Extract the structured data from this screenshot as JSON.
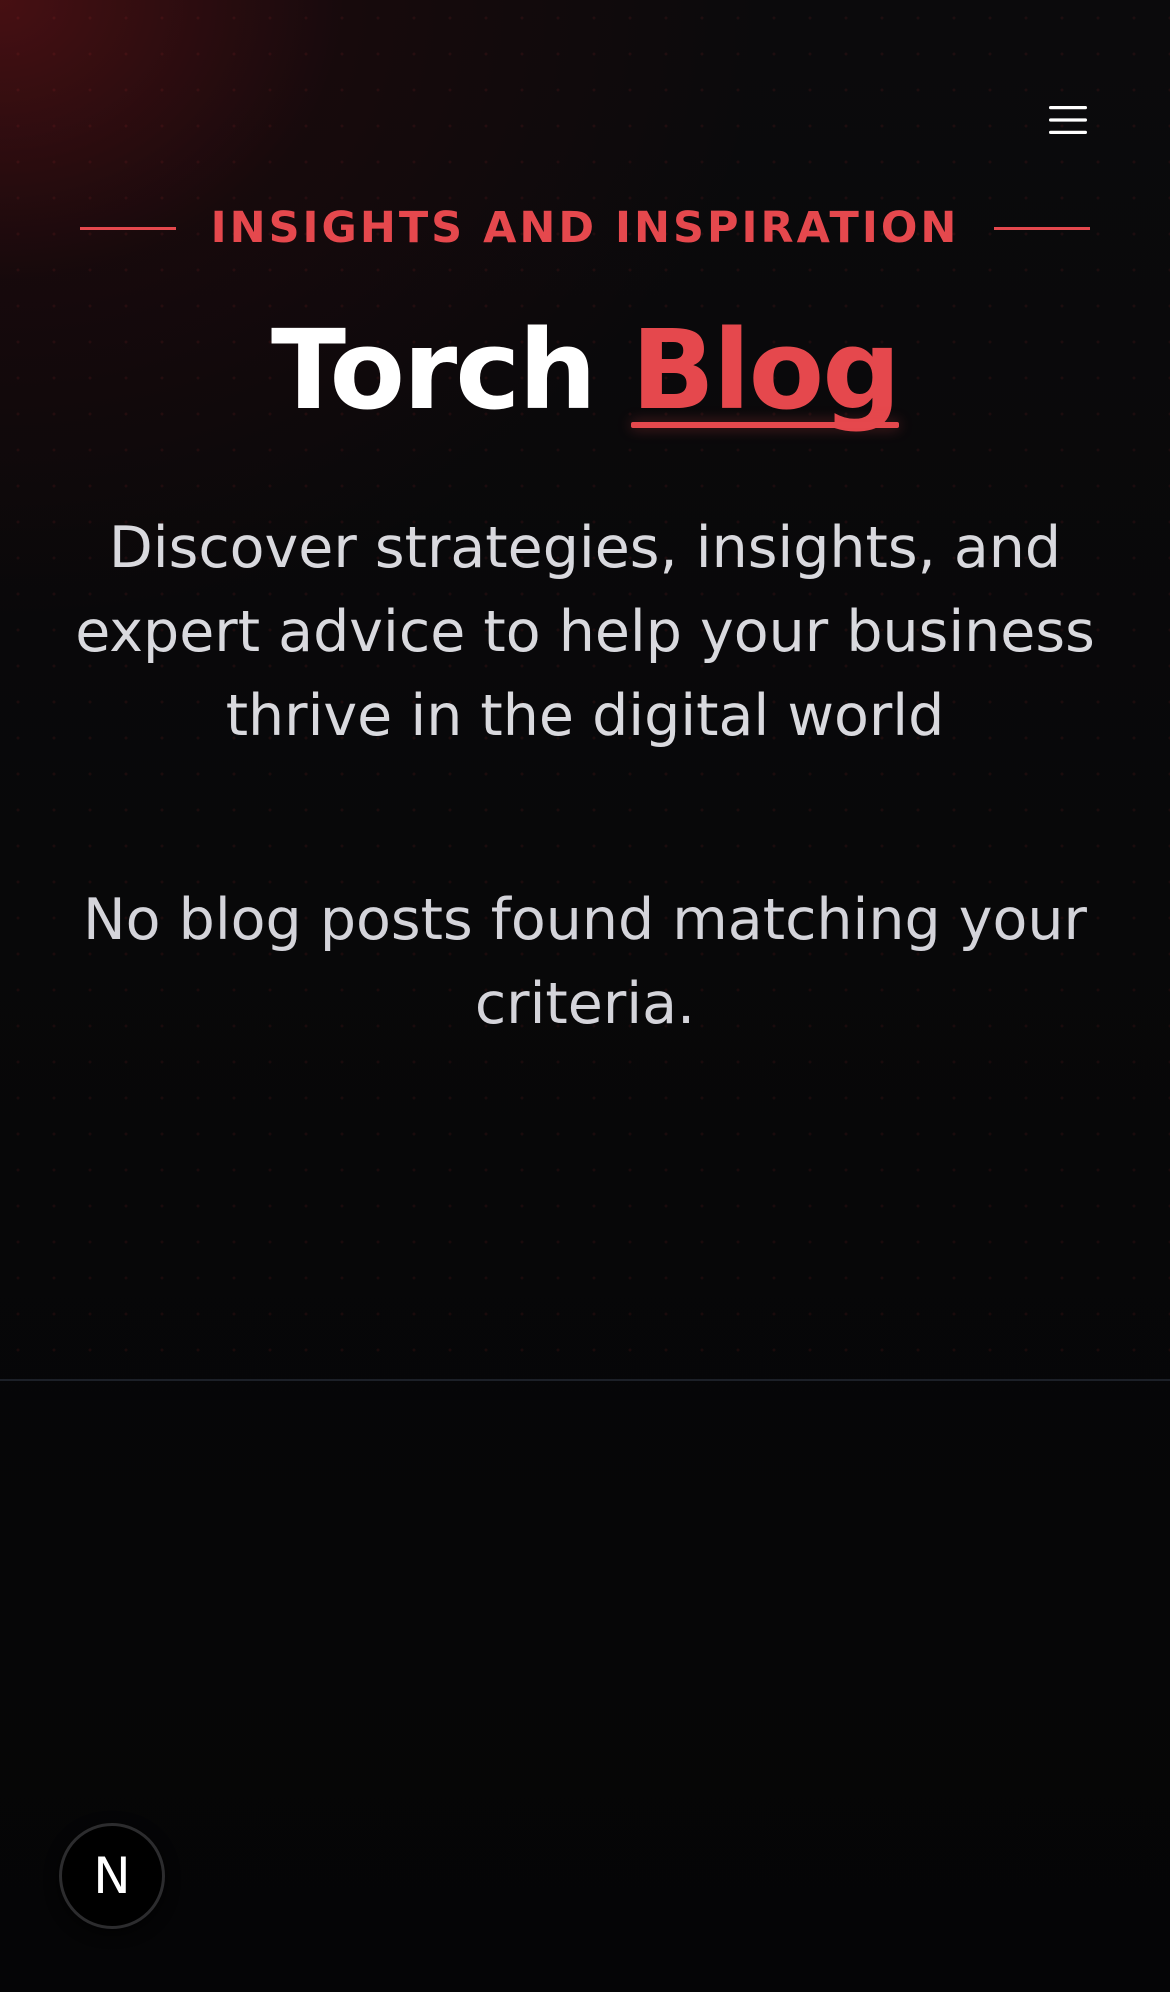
{
  "header": {
    "menu_icon": "hamburger-menu-icon"
  },
  "hero": {
    "eyebrow": "INSIGHTS AND INSPIRATION",
    "title_main": "Torch",
    "title_accent": "Blog",
    "subtitle": "Discover strategies, insights, and expert advice to help your business thrive in the digital world"
  },
  "blog_list": {
    "empty_message": "No blog posts found matching your criteria."
  },
  "dev_badge": {
    "letter": "N",
    "icon": "nextjs-logo-icon"
  },
  "colors": {
    "accent": "#e5484d",
    "background": "#070708",
    "text_primary": "#ffffff",
    "text_secondary": "#d9d9de"
  }
}
